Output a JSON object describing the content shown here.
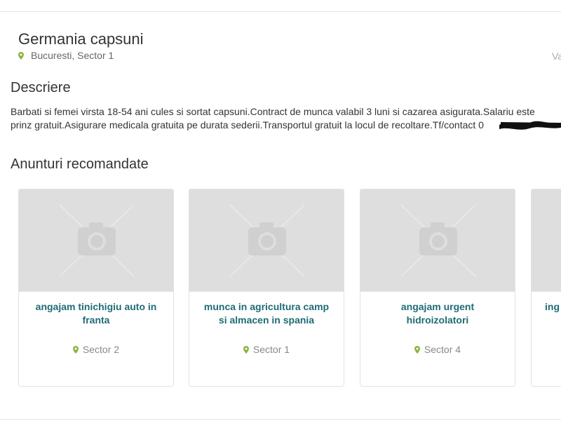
{
  "listing": {
    "title": "Germania capsuni",
    "location": "Bucuresti, Sector 1",
    "valability_label": "Vala"
  },
  "description": {
    "heading": "Descriere",
    "line1": "Barbati si femei virsta 18-54 ani cules si sortat capsuni.Contract de munca valabil 3 luni si cazarea asigurata.Salariu este",
    "line2": "prinz gratuit.Asigurare medicala gratuita pe durata sederii.Transportul gratuit la locul de recoltare.Tf/contact 0"
  },
  "recommended": {
    "heading": "Anunturi recomandate",
    "cards": [
      {
        "title": "angajam tinichigiu auto in franta",
        "location": "Sector 2"
      },
      {
        "title": "munca in agricultura camp si almacen in spania",
        "location": "Sector 1"
      },
      {
        "title": "angajam urgent hidroizolatori",
        "location": "Sector 4"
      },
      {
        "title": "ing",
        "location": ""
      }
    ]
  },
  "colors": {
    "accent_green": "#8cb33e",
    "card_title_teal": "#1f6b75",
    "placeholder_bg": "#dedede"
  },
  "icons": {
    "location": "map-pin-icon",
    "image_placeholder": "camera-placeholder-icon"
  }
}
